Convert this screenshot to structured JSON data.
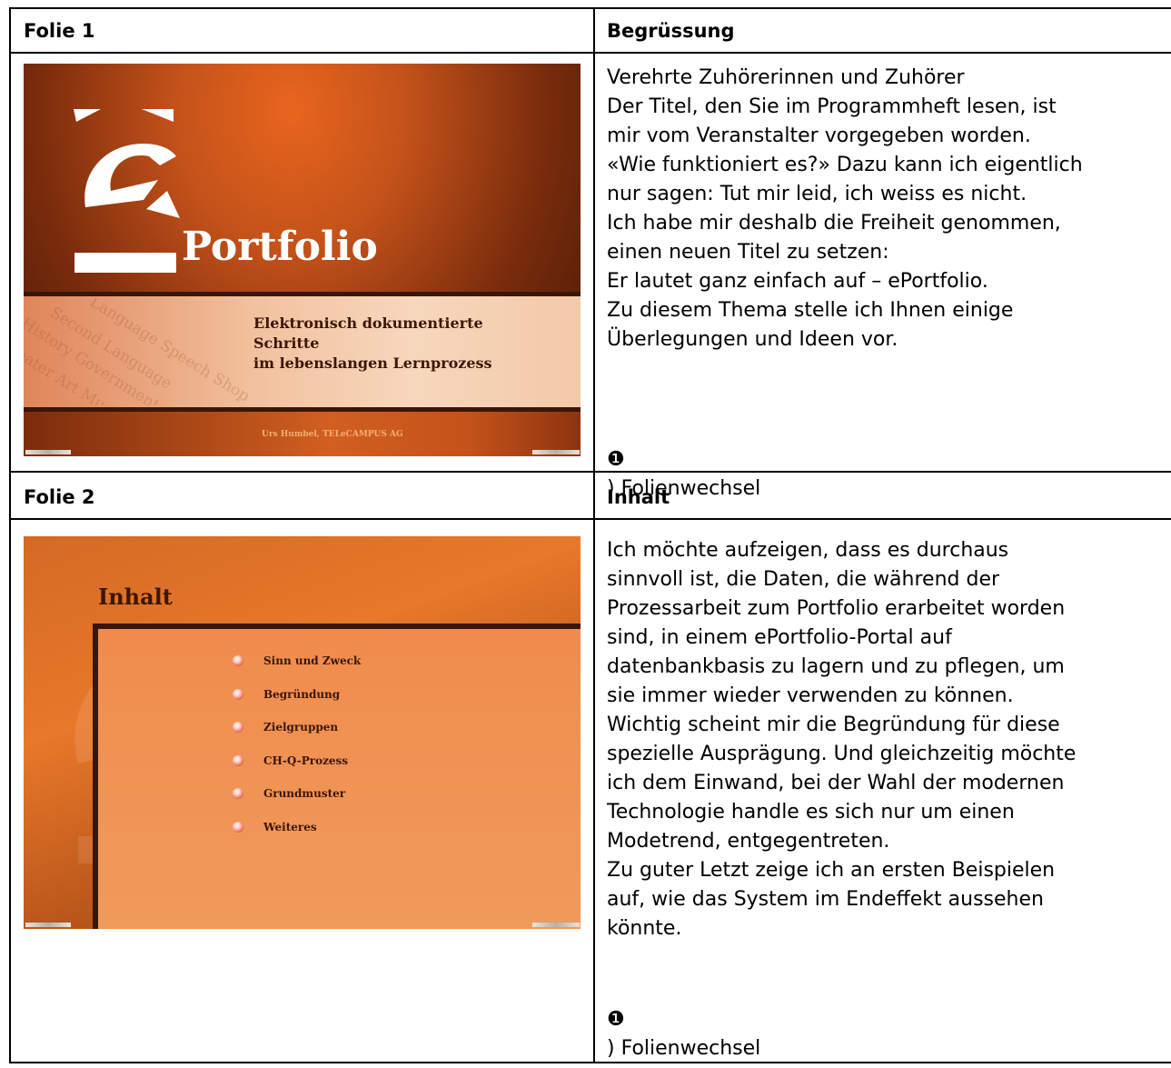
{
  "rows": [
    {
      "left_header": "Folie 1",
      "right_header": "Begrüssung",
      "slide": {
        "logo_word": "Portfolio",
        "subtitle": "Elektronisch dokumentierte\nSchritte\nim lebenslangen Lernprozess",
        "credit": "Urs Humbel, TELeCAMPUS AG",
        "watermark_words": [
          "Language Speech Shop",
          "Second Language",
          "History Government",
          "Theater Art Music"
        ]
      },
      "text": "Verehrte Zuhörerinnen und Zuhörer\nDer Titel, den Sie im Programmheft lesen, ist\nmir vom Veranstalter vorgegeben worden.\n«Wie funktioniert es?» Dazu kann ich eigentlich\nnur sagen: Tut mir leid, ich weiss es nicht.\nIch habe mir deshalb die Freiheit genommen,\neinen neuen Titel zu setzen:\nEr lautet ganz einfach auf – ePortfolio.\nZu diesem Thema stelle ich Ihnen einige\nÜberlegungen und Ideen vor.",
      "folienwechsel_icon": "❶",
      "folienwechsel": ") Folienwechsel"
    },
    {
      "left_header": "Folie 2",
      "right_header": "Inhalt",
      "slide": {
        "title": "Inhalt",
        "items": [
          "Sinn und Zweck",
          "Begründung",
          "Zielgruppen",
          "CH-Q-Prozess",
          "Grundmuster",
          "Weiteres"
        ]
      },
      "text": "Ich möchte aufzeigen, dass es durchaus\nsinnvoll ist, die Daten, die während der\nProzessarbeit zum Portfolio erarbeitet worden\nsind, in einem ePortfolio-Portal auf\ndatenbankbasis zu lagern und zu pflegen, um\nsie immer wieder verwenden zu können.\nWichtig scheint mir die Begründung für diese\nspezielle Ausprägung. Und gleichzeitig möchte\nich dem Einwand, bei der Wahl der modernen\nTechnologie handle es sich nur um einen\nModetrend, entgegentreten.\nZu guter Letzt zeige ich an ersten Beispielen\nauf, wie das System im Endeffekt aussehen\nkönnte.",
      "folienwechsel_icon": "❶",
      "folienwechsel": ") Folienwechsel"
    }
  ]
}
